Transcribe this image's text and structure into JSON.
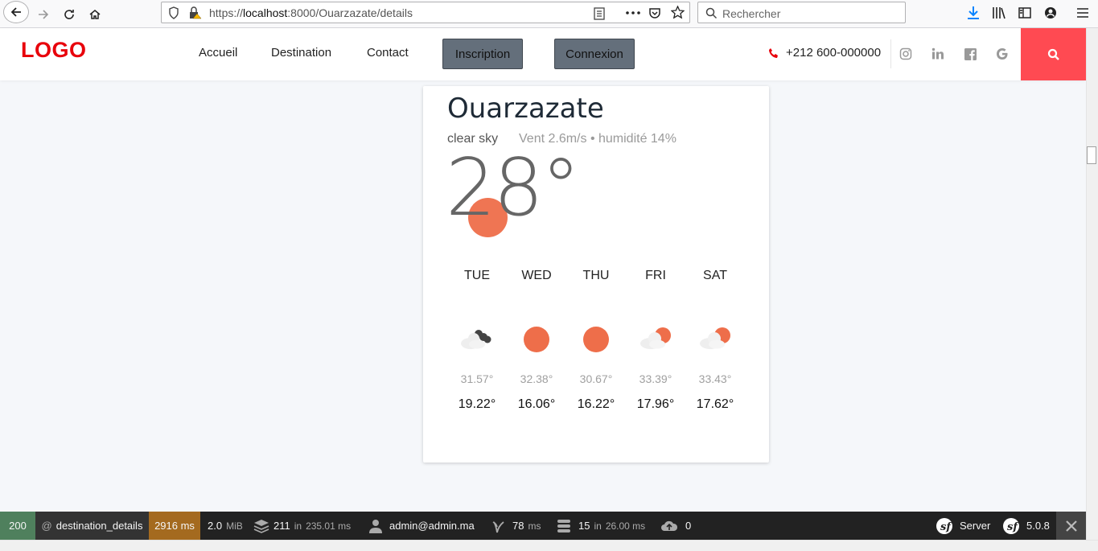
{
  "browser": {
    "url_prefix": "https://",
    "url_host": "localhost",
    "url_rest": ":8000/Ouarzazate/details",
    "search_placeholder": "Rechercher"
  },
  "header": {
    "logo": "LOGO",
    "nav": [
      "Accueil",
      "Destination",
      "Contact"
    ],
    "inscription": "Inscription",
    "connexion": "Connexion",
    "phone": "+212 600-000000",
    "accent_color": "#ff4a52"
  },
  "weather": {
    "city": "Ouarzazate",
    "description": "clear sky",
    "wind_humidity": "Vent 2.6m/s • humidité 14%",
    "temperature": "28°",
    "forecast": [
      {
        "day": "TUE",
        "icon": "partly-cloudy-night-icon",
        "high": "31.57°",
        "low": "19.22°"
      },
      {
        "day": "WED",
        "icon": "sun-icon",
        "high": "32.38°",
        "low": "16.06°"
      },
      {
        "day": "THU",
        "icon": "sun-icon",
        "high": "30.67°",
        "low": "16.22°"
      },
      {
        "day": "FRI",
        "icon": "partly-cloudy-day-icon",
        "high": "33.39°",
        "low": "17.96°"
      },
      {
        "day": "SAT",
        "icon": "partly-cloudy-day-icon",
        "high": "33.43°",
        "low": "17.62°"
      }
    ]
  },
  "toolbar": {
    "status": "200",
    "route": "destination_details",
    "time": "2916 ms",
    "memory": "2.0",
    "memory_unit": "MiB",
    "cache": "211",
    "cache_in": "in",
    "cache_time": "235.01 ms",
    "user": "admin@admin.ma",
    "twig_time": "78",
    "twig_unit": "ms",
    "db_queries": "15",
    "db_in": "in",
    "db_time": "26.00 ms",
    "ajax": "0",
    "server": "Server",
    "version": "5.0.8"
  }
}
